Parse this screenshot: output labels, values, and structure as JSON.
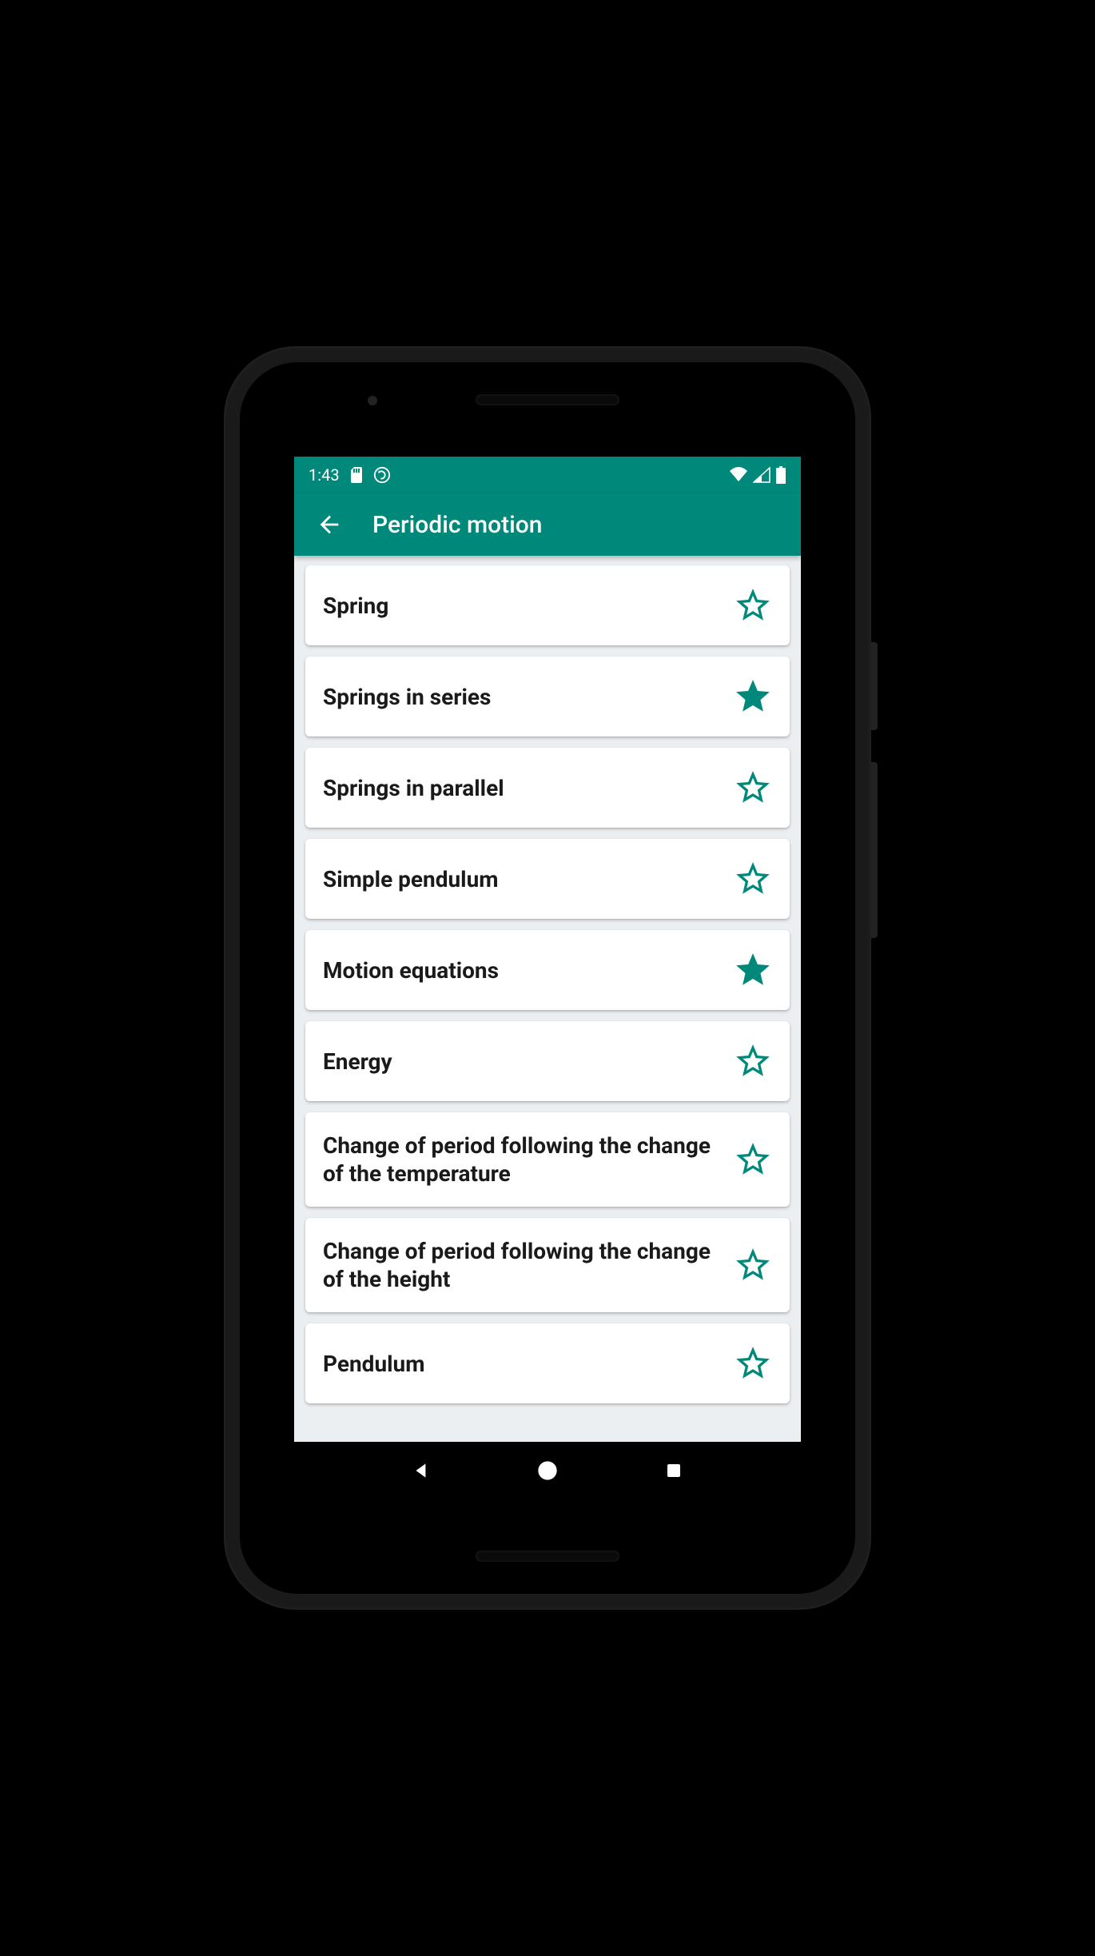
{
  "status": {
    "time": "1:43"
  },
  "header": {
    "title": "Periodic motion"
  },
  "accent": "#00897b",
  "items": [
    {
      "label": "Spring",
      "favorite": false
    },
    {
      "label": "Springs in series",
      "favorite": true
    },
    {
      "label": "Springs in parallel",
      "favorite": false
    },
    {
      "label": "Simple pendulum",
      "favorite": false
    },
    {
      "label": "Motion equations",
      "favorite": true
    },
    {
      "label": "Energy",
      "favorite": false
    },
    {
      "label": "Change of period following the change of the temperature",
      "favorite": false
    },
    {
      "label": "Change of period following the change of the height",
      "favorite": false
    },
    {
      "label": "Pendulum",
      "favorite": false
    }
  ]
}
